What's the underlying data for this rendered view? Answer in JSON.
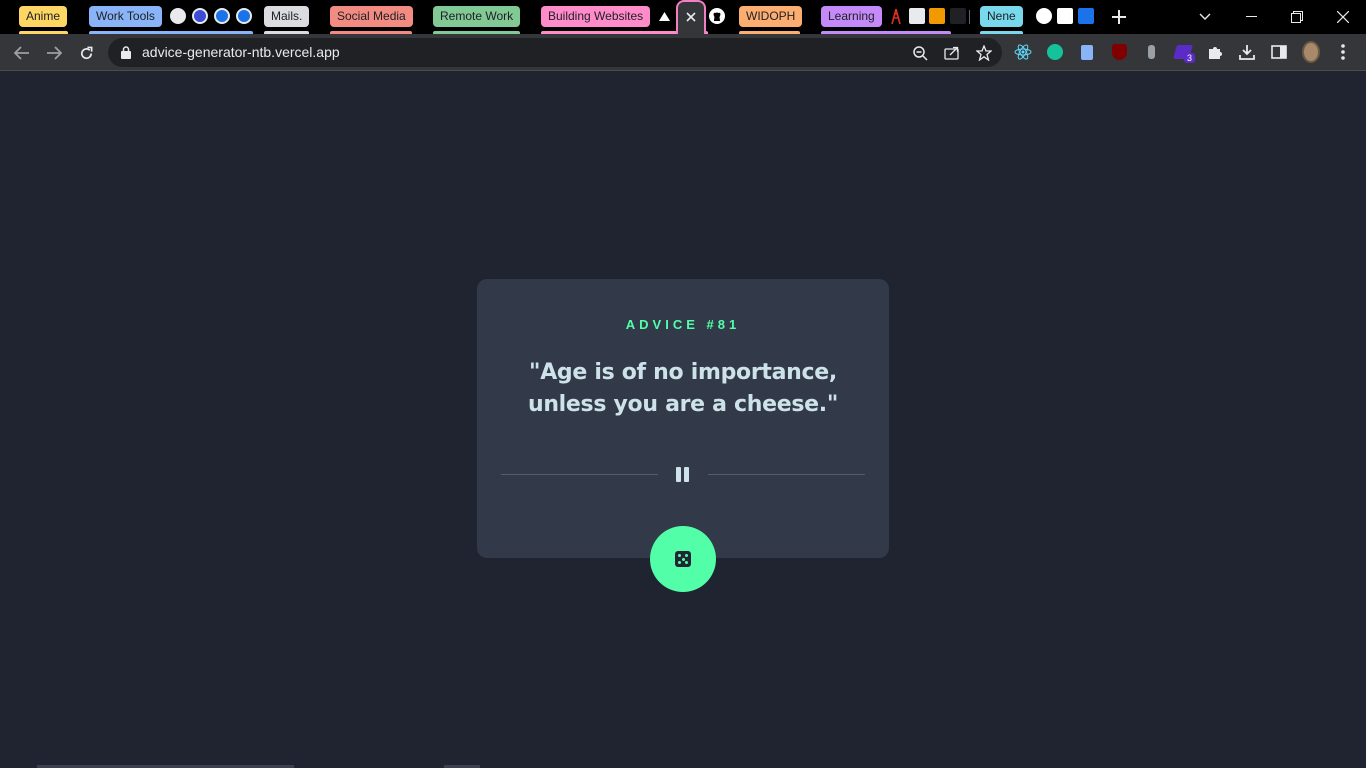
{
  "browser": {
    "tab_groups": [
      {
        "label": "Anime",
        "color": "#fdd663"
      },
      {
        "label": "Work Tools",
        "color": "#8ab4f8"
      },
      {
        "label": "Mails.",
        "color": "#dadce0"
      },
      {
        "label": "Social Media",
        "color": "#f28b82"
      },
      {
        "label": "Remote Work",
        "color": "#81c995"
      },
      {
        "label": "Building Websites",
        "color": "#ff8bcb"
      },
      {
        "label": "WIDOPH",
        "color": "#fcad70"
      },
      {
        "label": "Learning",
        "color": "#c58af9"
      },
      {
        "label": "Nene",
        "color": "#78d9ec"
      }
    ],
    "active_tab_close": "×",
    "url": "advice-generator-ntb.vercel.app",
    "extension_badge": "3"
  },
  "advice": {
    "heading": "ADVICE #81",
    "quote": "\"Age is of no importance, unless you are a cheese.\""
  },
  "colors": {
    "background": "#1f2430",
    "card": "#323a49",
    "accent": "#52ffa8",
    "text": "#cee3e9"
  },
  "icons": {
    "divider": "pause-icon",
    "button": "dice-icon"
  }
}
